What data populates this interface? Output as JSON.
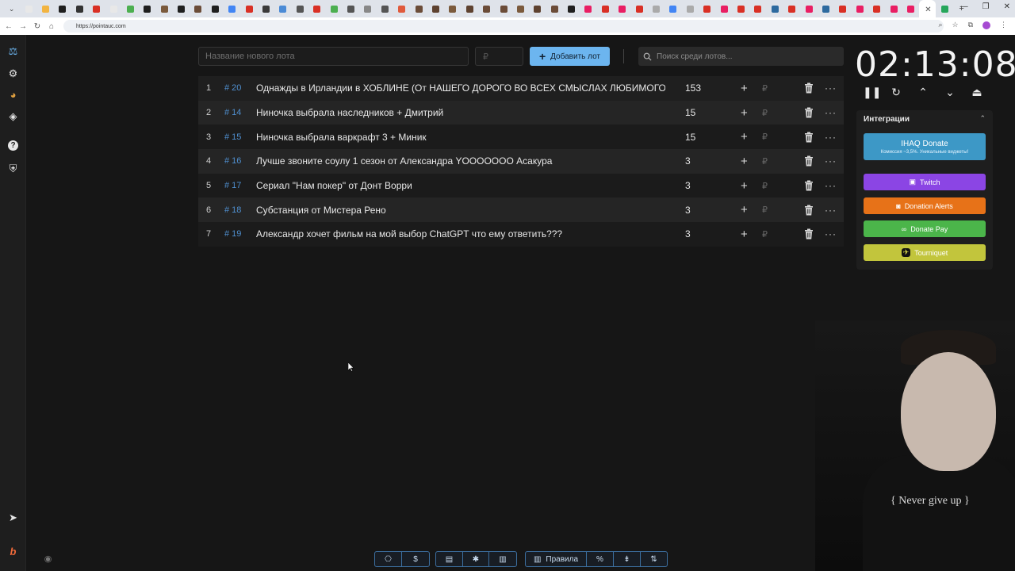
{
  "browser": {
    "url": "https://pointauc.com",
    "tab_colors": [
      "#e8e8e8",
      "#f2b441",
      "#1f1f1f",
      "#333333",
      "#d93025",
      "#e8e8e8",
      "#4caf50",
      "#1f1f1f",
      "#7b5a3c",
      "#1f1f1f",
      "#6b4c38",
      "#1f1f1f",
      "#4285f4",
      "#d93025",
      "#3a3a3a",
      "#4b8bd6",
      "#555555",
      "#d93025",
      "#4caf50",
      "#555555",
      "#888888",
      "#555555",
      "#e05a3c",
      "#6b4c38",
      "#5e4230",
      "#7b5a3c",
      "#5e4230",
      "#6b4c38",
      "#6b4c38",
      "#7b5a3c",
      "#5e4230",
      "#6b4c38",
      "#1f1f1f",
      "#e91e63",
      "#d93025",
      "#e91e63",
      "#d93025",
      "#aaaaaa",
      "#4285f4",
      "#aaaaaa",
      "#d93025",
      "#e91e63",
      "#d93025",
      "#d93025",
      "#2d6a9f",
      "#d93025",
      "#e91e63",
      "#2d6a9f",
      "#d93025",
      "#e91e63",
      "#d93025",
      "#e91e63",
      "#e91e63",
      "#ffffff",
      "#26a65b"
    ]
  },
  "sidebar": {
    "items": [
      {
        "name": "auction-gavel-icon",
        "glyph": "⚖"
      },
      {
        "name": "settings-gear-icon",
        "glyph": "⚙"
      },
      {
        "name": "wheel-chart-icon",
        "glyph": "◕"
      },
      {
        "name": "layers-icon",
        "glyph": "◈"
      },
      {
        "name": "help-icon",
        "glyph": "?"
      },
      {
        "name": "shield-icon",
        "glyph": "⛨"
      }
    ],
    "bottom": [
      {
        "name": "telegram-icon",
        "glyph": "➤"
      },
      {
        "name": "boosty-icon",
        "glyph": "b"
      }
    ]
  },
  "toolbar": {
    "lot_name_placeholder": "Название нового лота",
    "amount_placeholder": "₽",
    "add_label": "Добавить лот",
    "search_placeholder": "Поиск среди лотов..."
  },
  "lots": [
    {
      "index": "1",
      "id": "# 20",
      "name": "Однажды в Ирландии в ХОБЛИНЕ (От НАШЕГО ДОРОГО ВО ВСЕХ СМЫСЛАХ ЛЮБИМОГО ОМЕ",
      "amount": "153"
    },
    {
      "index": "2",
      "id": "# 14",
      "name": "Ниночка выбрала наследников + Дмитрий",
      "amount": "15"
    },
    {
      "index": "3",
      "id": "# 15",
      "name": "Ниночка выбрала варкрафт 3  + Миник",
      "amount": "15"
    },
    {
      "index": "4",
      "id": "# 16",
      "name": "Лучше звоните соулу 1 сезон от Александра YOOOOOOO Асакура",
      "amount": "3"
    },
    {
      "index": "5",
      "id": "# 17",
      "name": "Сериал \"Нам покер\" от Донт Ворри",
      "amount": "3"
    },
    {
      "index": "6",
      "id": "# 18",
      "name": "Субстанция от Мистера Рено",
      "amount": "3"
    },
    {
      "index": "7",
      "id": "# 19",
      "name": "Александр хочет фильм на мой выбор ChatGPT что ему ответить???",
      "amount": "3"
    }
  ],
  "row_symbols": {
    "plus": "+",
    "rub": "₽",
    "more": "···"
  },
  "timer": {
    "value": "02:13:08",
    "controls": [
      "❚❚",
      "↻",
      "⌃",
      "⌄",
      "⏏"
    ]
  },
  "integrations": {
    "title": "Интеграции",
    "ihaq_label": "IHAQ Donate",
    "ihaq_sub": "Комиссия ~3,5%. Уникальные виджеты!",
    "twitch_label": "Twitch",
    "donation_alerts_label": "Donation Alerts",
    "donate_pay_label": "Donate Pay",
    "tourniquet_label": "Tourniquet"
  },
  "webcam": {
    "shirt_text": "{ Never give up }"
  },
  "bottombar": {
    "group1": [
      "⎔",
      "$"
    ],
    "group2": [
      "▤",
      "✱",
      "▥"
    ],
    "rules_label": "Правила",
    "group3": [
      "%",
      "⇟",
      "⇅"
    ]
  }
}
